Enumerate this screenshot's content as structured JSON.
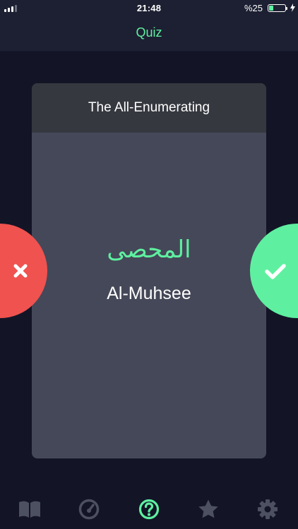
{
  "status_bar": {
    "time": "21:48",
    "battery_text": "%25",
    "battery_level": 0.25,
    "signal_bars_filled": 3,
    "signal_bars_total": 4
  },
  "nav": {
    "title": "Quiz"
  },
  "card": {
    "meaning": "The All-Enumerating",
    "arabic": "المحصى",
    "transliteration": "Al-Muhsee"
  },
  "buttons": {
    "wrong_icon": "close-icon",
    "right_icon": "check-icon"
  },
  "tabs": [
    {
      "icon": "book-icon",
      "active": false
    },
    {
      "icon": "speedometer-icon",
      "active": false
    },
    {
      "icon": "question-icon",
      "active": true
    },
    {
      "icon": "star-icon",
      "active": false
    },
    {
      "icon": "gear-icon",
      "active": false
    }
  ],
  "colors": {
    "background": "#131526",
    "bar": "#1d2032",
    "accent": "#5ef0a0",
    "wrong": "#f0524f",
    "card": "#454858",
    "card_header": "#36383f",
    "tab_inactive": "#4d5061"
  }
}
